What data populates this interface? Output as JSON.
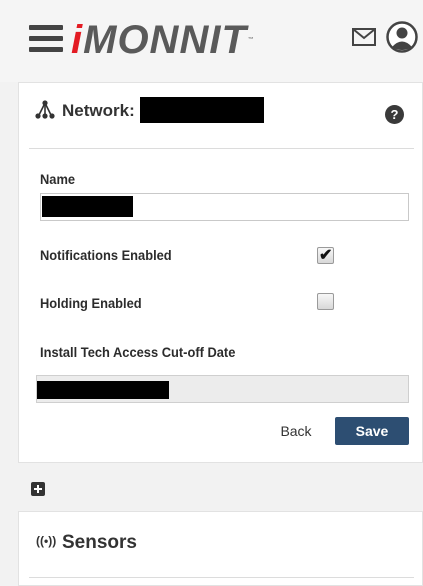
{
  "header": {
    "logo_text": "MONNIT",
    "logo_mark": "i",
    "logo_tm": "™",
    "icons": [
      "hamburger-menu-icon",
      "mail-icon",
      "user-account-icon"
    ],
    "accent_color": "#e31b23"
  },
  "network_card": {
    "title_label": "Network:",
    "title_value_redacted": true,
    "help_icon": "question-circle-icon",
    "help_text": "?",
    "fields": {
      "name_label": "Name",
      "name_value_redacted": true,
      "notifications_label": "Notifications Enabled",
      "notifications_checked": true,
      "holding_label": "Holding Enabled",
      "holding_checked": false,
      "cutoff_label": "Install Tech Access Cut-off Date",
      "cutoff_value_redacted": true
    },
    "back_label": "Back",
    "save_label": "Save",
    "save_color": "#2d4e72"
  },
  "expand_icon": "plus-square-icon",
  "sensors_card": {
    "icon": "broadcast-signal-icon",
    "icon_text": "((•))",
    "title": "Sensors"
  }
}
